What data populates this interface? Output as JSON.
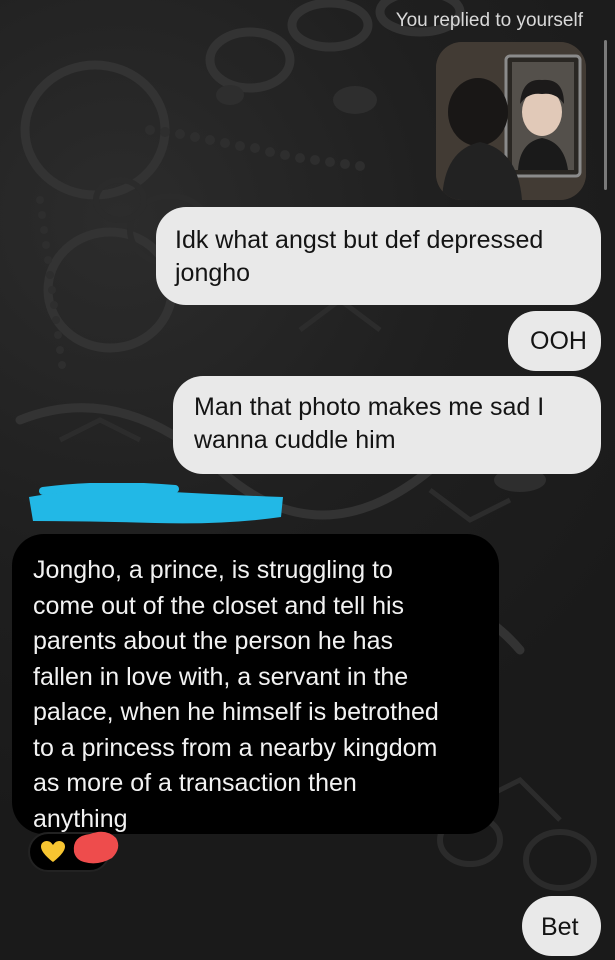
{
  "reply_header": {
    "text": "You replied to yourself"
  },
  "messages": [
    {
      "text": "Idk what angst but def depressed\njongho"
    },
    {
      "text": "OOH"
    },
    {
      "text": "Man that photo makes me sad I\nwanna cuddle him"
    },
    {
      "text": "Jongho, a prince, is struggling to\ncome out of the closet and tell his\nparents about the person he has\nfallen in love with, a servant in the\npalace, when he himself is betrothed\nto a princess from a nearby kingdom\nas more of a transaction then\nanything"
    },
    {
      "text": "Bet"
    }
  ],
  "reaction": {
    "emoji": "yellow-heart-icon"
  },
  "colors": {
    "sent_bubble": "#e9e9e9",
    "received_bubble": "#000000",
    "redaction_blue": "#22b8e6",
    "redaction_red": "#ee4c4c",
    "heart_yellow": "#f7c531"
  }
}
